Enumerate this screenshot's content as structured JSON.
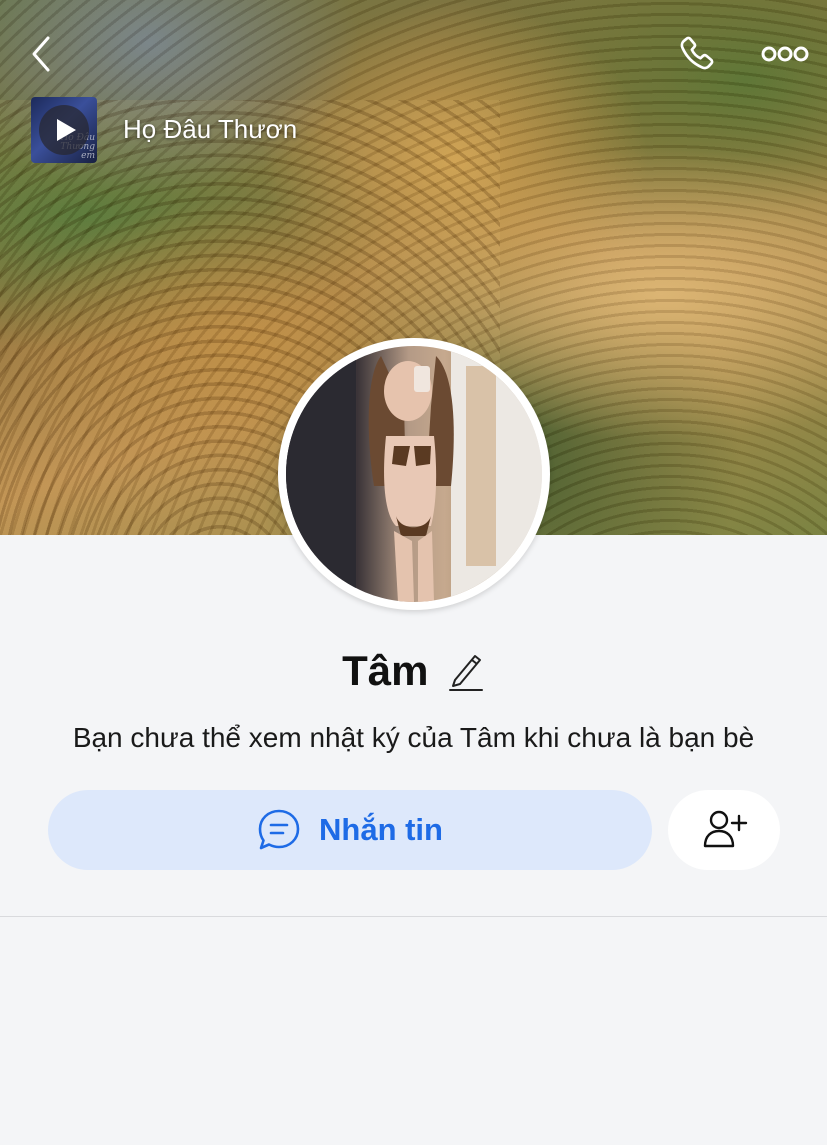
{
  "header": {
    "music": {
      "song_title": "Họ Đâu Thươn",
      "cover_text": "Họ Đâu Thương em"
    }
  },
  "profile": {
    "name": "Tâm",
    "privacy_note": "Bạn chưa thể xem nhật ký của Tâm khi chưa là bạn bè"
  },
  "actions": {
    "message_label": "Nhắn tin"
  },
  "icons": {
    "back": "chevron-left-icon",
    "call": "phone-icon",
    "more": "more-horizontal-icon",
    "play": "play-icon",
    "edit": "pencil-icon",
    "message": "chat-bubble-icon",
    "add_friend": "user-plus-icon"
  },
  "colors": {
    "accent": "#1e6be6",
    "message_button_bg": "#dde8fb",
    "page_bg": "#f4f5f7"
  }
}
